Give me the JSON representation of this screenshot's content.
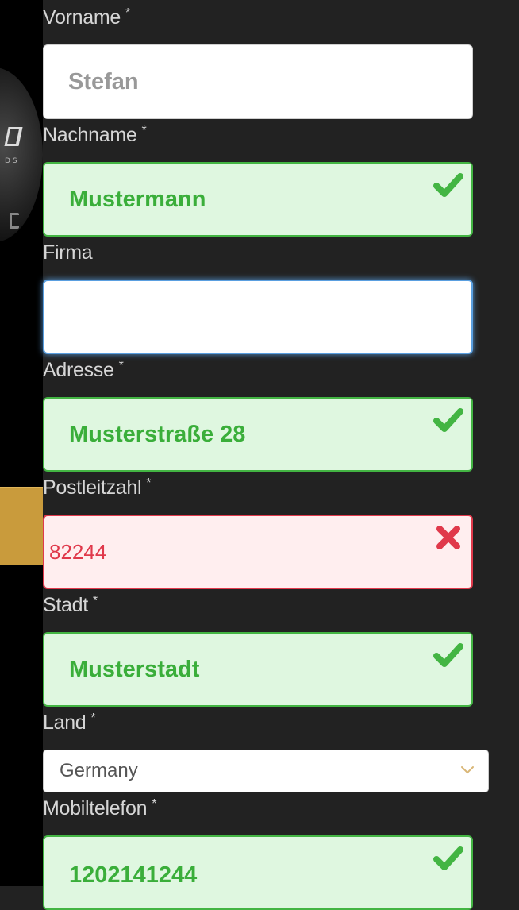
{
  "form": {
    "vorname": {
      "label": "Vorname",
      "required": "*",
      "placeholder": "Stefan"
    },
    "nachname": {
      "label": "Nachname",
      "required": "*",
      "value": "Mustermann",
      "status": "valid"
    },
    "firma": {
      "label": "Firma",
      "value": ""
    },
    "adresse": {
      "label": "Adresse",
      "required": "*",
      "value": "Musterstraße 28",
      "status": "valid"
    },
    "plz": {
      "label": "Postleitzahl",
      "required": "*",
      "value": "82244",
      "status": "invalid"
    },
    "stadt": {
      "label": "Stadt",
      "required": "*",
      "value": "Musterstadt",
      "status": "valid"
    },
    "land": {
      "label": "Land",
      "required": "*",
      "selected": "Germany"
    },
    "mobil": {
      "label": "Mobiltelefon",
      "required": "*",
      "value": "1202141244",
      "status": "valid"
    }
  },
  "colors": {
    "background": "#222222",
    "valid": "#43b543",
    "invalid": "#e0394b",
    "focus": "#5a9fe0",
    "accent_gold": "#c99b3c"
  },
  "icons": {
    "valid": "check-icon",
    "invalid": "cross-icon",
    "select": "chevron-down-icon"
  }
}
